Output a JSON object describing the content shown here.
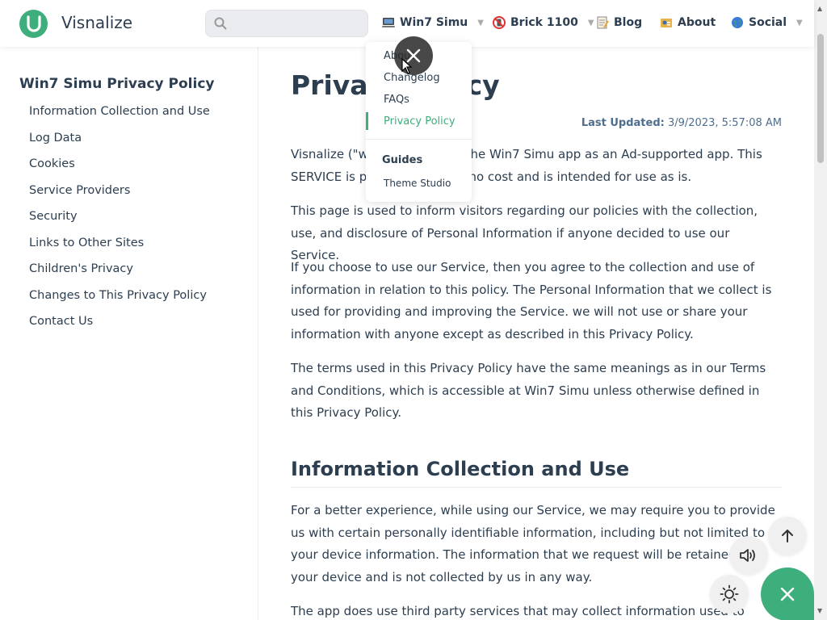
{
  "brand": {
    "name": "Visnalize"
  },
  "search": {
    "placeholder": ""
  },
  "nav": {
    "items": [
      {
        "label": "Win7 Simu",
        "icon": "computer-icon"
      },
      {
        "label": "Brick 1100",
        "icon": "brick-phone-icon"
      },
      {
        "label": "Blog",
        "icon": "memo-icon"
      },
      {
        "label": "About",
        "icon": "id-card-icon"
      },
      {
        "label": "Social",
        "icon": "globe-icon"
      }
    ]
  },
  "dropdown": {
    "items": [
      "About",
      "Changelog",
      "FAQs",
      "Privacy Policy"
    ],
    "group_title": "Guides",
    "group_items": [
      "Theme Studio"
    ]
  },
  "sidebar": {
    "title": "Win7 Simu Privacy Policy",
    "links": [
      "Information Collection and Use",
      "Log Data",
      "Cookies",
      "Service Providers",
      "Security",
      "Links to Other Sites",
      "Children's Privacy",
      "Changes to This Privacy Policy",
      "Contact Us"
    ]
  },
  "main": {
    "title": "Privacy Policy",
    "updated_label": "Last Updated:",
    "updated_value": "3/9/2023, 5:57:08 AM",
    "paragraphs": [
      "Visnalize (\"we\" or \"us\") built the Win7 Simu app as an Ad-supported app. This SERVICE is provided by us at no cost and is intended for use as is.",
      "This page is used to inform visitors regarding our policies with the collection, use, and disclosure of Personal Information if anyone decided to use our Service.",
      "If you choose to use our Service, then you agree to the collection and use of information in relation to this policy. The Personal Information that we collect is used for providing and improving the Service. we will not use or share your information with anyone except as described in this Privacy Policy.",
      "The terms used in this Privacy Policy have the same meanings as in our Terms and Conditions, which is accessible at Win7 Simu unless otherwise defined in this Privacy Policy."
    ],
    "section_heading": "Information Collection and Use",
    "section_paragraphs": [
      "For a better experience, while using our Service, we may require you to provide us with certain personally identifiable information, including but not limited to your device information. The information that we request will be retained on your device and is not collected by us in any way.",
      "The app does use third party services that may collect information used to identify you."
    ]
  },
  "colors": {
    "accent": "#3eaf7c",
    "text": "#2c3e50"
  }
}
